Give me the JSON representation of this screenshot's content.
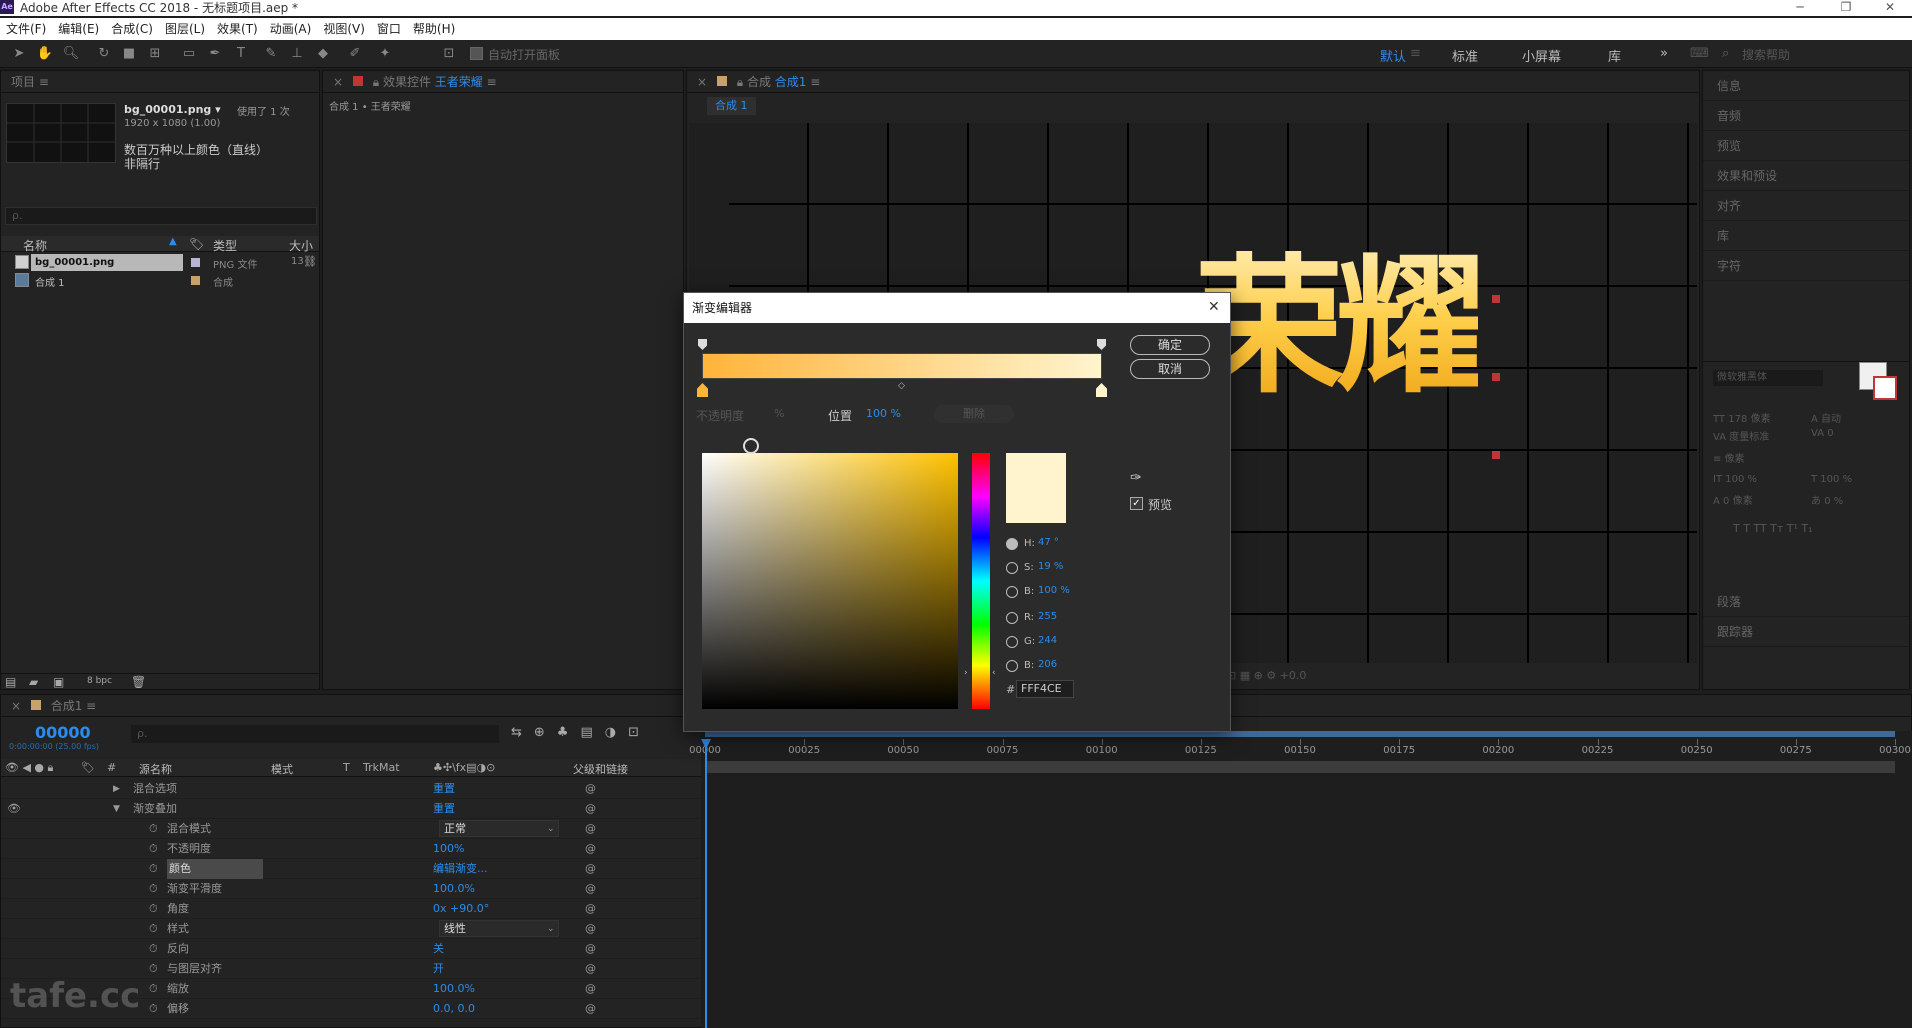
{
  "window": {
    "title": "Adobe After Effects CC 2018 - 无标题项目.aep *"
  },
  "menu": [
    "文件(F)",
    "编辑(E)",
    "合成(C)",
    "图层(L)",
    "效果(T)",
    "动画(A)",
    "视图(V)",
    "窗口",
    "帮助(H)"
  ],
  "toolbar": {
    "auto_open": "自动打开面板",
    "workspaces": [
      "默认",
      "标准",
      "小屏幕",
      "库"
    ],
    "search_placeholder": "搜索帮助"
  },
  "project": {
    "panel_title": "项目",
    "file_name": "bg_00001.png ▾",
    "usage": "使用了 1 次",
    "dims": "1920 x 1080 (1.00)",
    "colors": "数百万种以上颜色（直线）",
    "interlace": "非隔行",
    "search_placeholder": "ρ.",
    "columns": {
      "name": "名称",
      "type": "类型",
      "size": "大小"
    },
    "items": [
      {
        "name": "bg_00001.png",
        "type": "PNG 文件",
        "size": "13",
        "color": "#b9b3d6"
      },
      {
        "name": "合成 1",
        "type": "合成",
        "size": "",
        "color": "#c5a36a"
      }
    ],
    "bpc": "8 bpc"
  },
  "effects": {
    "panel_title": "效果控件",
    "layer": "王者荣耀",
    "breadcrumb": "合成 1 • 王者荣耀"
  },
  "comp": {
    "panel_title": "合成",
    "comp_name": "合成1",
    "tab_label": "合成 1",
    "glyph_text": "荣耀",
    "accent_text_color": "#ffcf4a"
  },
  "right_panels": [
    "信息",
    "音频",
    "预览",
    "效果和预设",
    "对齐",
    "库",
    "字符",
    "段落",
    "跟踪器"
  ],
  "character": {
    "font_family": "微软雅黑体",
    "size": "178 像素",
    "leading": "自动",
    "kern": "度量标准",
    "tracking": "0",
    "stroke": "像素",
    "vscale": "100 %",
    "hscale": "100 %",
    "baseline": "0 像素",
    "tsume": "0 %"
  },
  "timeline": {
    "tab": "合成1",
    "timecode": "00000",
    "timecode_sub": "0:00:00:00 (25.00 fps)",
    "search_placeholder": "ρ.",
    "headers": {
      "source": "源名称",
      "mode": "模式",
      "t": "T",
      "trkmat": "TrkMat",
      "parent": "父级和链接"
    },
    "ruler": [
      "00000",
      "00025",
      "00050",
      "00075",
      "00100",
      "00125",
      "00150",
      "00175",
      "00200",
      "00225",
      "00250",
      "00275",
      "00300"
    ],
    "rows": [
      {
        "label": "混合选项",
        "value": "重置",
        "value_color": "#2d8ceb",
        "twirl": "▶",
        "indent": 1
      },
      {
        "label": "渐变叠加",
        "value": "重置",
        "value_color": "#2d8ceb",
        "twirl": "▼",
        "indent": 1
      },
      {
        "label": "混合模式",
        "value": "正常",
        "dropdown": true,
        "indent": 2
      },
      {
        "label": "不透明度",
        "value": "100%",
        "indent": 2
      },
      {
        "label": "颜色",
        "value": "编辑渐变...",
        "indent": 2,
        "selected": true
      },
      {
        "label": "渐变平滑度",
        "value": "100.0%",
        "indent": 2
      },
      {
        "label": "角度",
        "value": "0x +90.0°",
        "indent": 2
      },
      {
        "label": "样式",
        "value": "线性",
        "dropdown": true,
        "indent": 2
      },
      {
        "label": "反向",
        "value": "关",
        "indent": 2
      },
      {
        "label": "与图层对齐",
        "value": "开",
        "indent": 2
      },
      {
        "label": "缩放",
        "value": "100.0%",
        "indent": 2
      },
      {
        "label": "偏移",
        "value": "0.0, 0.0",
        "indent": 2
      }
    ]
  },
  "gradient_editor": {
    "title": "渐变编辑器",
    "ok": "确定",
    "cancel": "取消",
    "opacity_label": "不透明度",
    "opacity_value": "%",
    "position_label": "位置",
    "position_value": "100 %",
    "delete": "删除",
    "preview_label": "预览",
    "hex_prefix": "#",
    "hex": "FFF4CE",
    "hsb": [
      {
        "label": "H:",
        "value": "47 °"
      },
      {
        "label": "S:",
        "value": "19 %"
      },
      {
        "label": "B:",
        "value": "100 %"
      }
    ],
    "rgb": [
      {
        "label": "R:",
        "value": "255"
      },
      {
        "label": "G:",
        "value": "244"
      },
      {
        "label": "B:",
        "value": "206"
      }
    ],
    "stop_start_color": "#ffb43a",
    "stop_end_color": "#fff4ce",
    "field_hue_color": "#ffc200"
  },
  "watermark": "tafe.cc"
}
